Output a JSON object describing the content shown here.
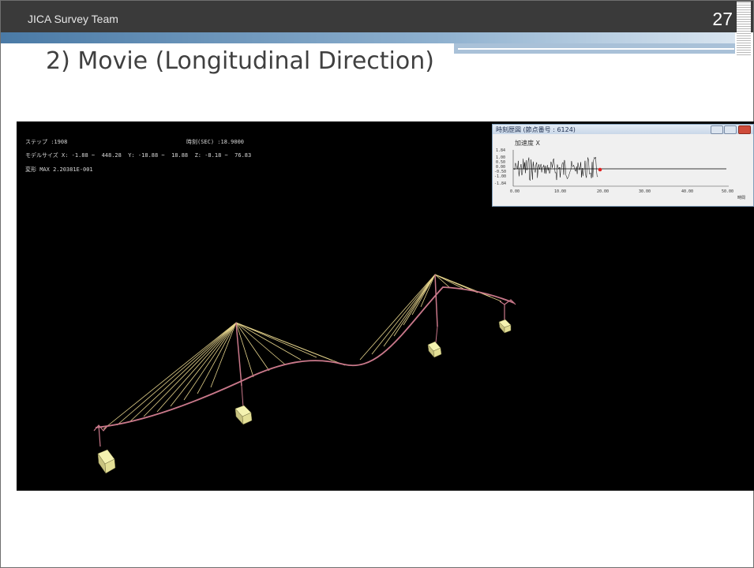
{
  "header": {
    "team": "JICA Survey Team",
    "page_number": "27"
  },
  "slide": {
    "title": "2) Movie (Longitudinal Direction)"
  },
  "video": {
    "step_text": "ステップ :1908",
    "time_text": "時刻(SEC) :18.9000",
    "model_size_text": "モデルサイズ X: -1.88 ~  448.28  Y: -18.88 ~  18.88  Z: -8.18 ~  76.83",
    "deform_text": "変形 MAX 2.20381E-001"
  },
  "graph_window": {
    "title": "時刻歴図 (節点番号 : 6124)",
    "y_label": "加速度 X",
    "y_ticks": [
      "1.84",
      "1.00",
      "0.50",
      "0.00",
      "-0.50",
      "-1.00",
      "-1.84"
    ],
    "x_ticks": [
      "0.00",
      "10.00",
      "20.00",
      "30.00",
      "40.00",
      "50.00"
    ],
    "x_unit": "時間",
    "colors": {
      "trace": "#000000",
      "marker": "#e02020"
    }
  },
  "bridge": {
    "colors": {
      "deck": "#c9788a",
      "cable": "#e6d48c",
      "foundation": "#f2f0a6"
    }
  }
}
